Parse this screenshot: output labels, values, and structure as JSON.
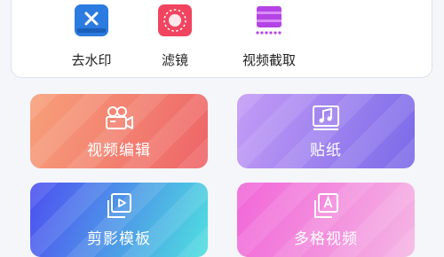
{
  "tools": [
    {
      "label": "去水印",
      "icon": "watermark-remove-icon",
      "color": "#2b7be0"
    },
    {
      "label": "滤镜",
      "icon": "filter-icon",
      "color": "#f1445f"
    },
    {
      "label": "视频截取",
      "icon": "video-trim-icon",
      "color": "#b444e6"
    }
  ],
  "cards": [
    {
      "label": "视频编辑",
      "icon": "video-camera-icon"
    },
    {
      "label": "贴纸",
      "icon": "sticker-music-icon"
    },
    {
      "label": "剪影模板",
      "icon": "template-play-icon"
    },
    {
      "label": "多格视频",
      "icon": "multi-grid-icon"
    }
  ]
}
